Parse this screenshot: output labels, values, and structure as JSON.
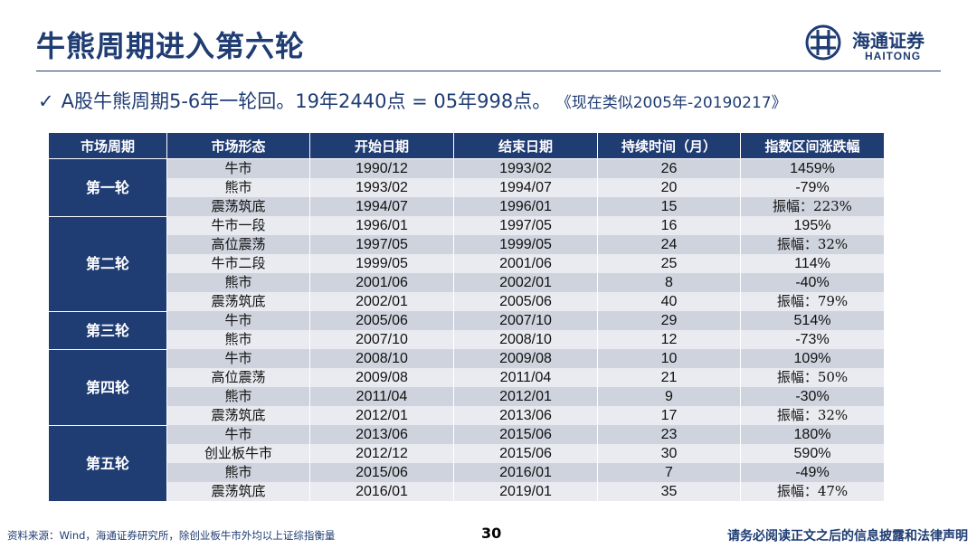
{
  "slide": {
    "title": "牛熊周期进入第六轮",
    "logo_cn": "海通证券",
    "logo_en": "HAITONG",
    "headline_check": "✓",
    "headline": "A股牛熊周期5-6年一轮回。19年2440点 = 05年998点。",
    "headline_note": "《现在类似2005年-20190217》"
  },
  "table": {
    "headers": [
      "市场周期",
      "市场形态",
      "开始日期",
      "结束日期",
      "持续时间（月）",
      "指数区间涨跌幅"
    ],
    "groups": [
      {
        "round": "第一轮",
        "rows": [
          [
            "牛市",
            "1990/12",
            "1993/02",
            "26",
            "1459%"
          ],
          [
            "熊市",
            "1993/02",
            "1994/07",
            "20",
            "-79%"
          ],
          [
            "震荡筑底",
            "1994/07",
            "1996/01",
            "15",
            "振幅：223%"
          ]
        ]
      },
      {
        "round": "第二轮",
        "rows": [
          [
            "牛市一段",
            "1996/01",
            "1997/05",
            "16",
            "195%"
          ],
          [
            "高位震荡",
            "1997/05",
            "1999/05",
            "24",
            "振幅：32%"
          ],
          [
            "牛市二段",
            "1999/05",
            "2001/06",
            "25",
            "114%"
          ],
          [
            "熊市",
            "2001/06",
            "2002/01",
            "8",
            "-40%"
          ],
          [
            "震荡筑底",
            "2002/01",
            "2005/06",
            "40",
            "振幅：79%"
          ]
        ]
      },
      {
        "round": "第三轮",
        "rows": [
          [
            "牛市",
            "2005/06",
            "2007/10",
            "29",
            "514%"
          ],
          [
            "熊市",
            "2007/10",
            "2008/10",
            "12",
            "-73%"
          ]
        ]
      },
      {
        "round": "第四轮",
        "rows": [
          [
            "牛市",
            "2008/10",
            "2009/08",
            "10",
            "109%"
          ],
          [
            "高位震荡",
            "2009/08",
            "2011/04",
            "21",
            "振幅：50%"
          ],
          [
            "熊市",
            "2011/04",
            "2012/01",
            "9",
            "-30%"
          ],
          [
            "震荡筑底",
            "2012/01",
            "2013/06",
            "17",
            "振幅：32%"
          ]
        ]
      },
      {
        "round": "第五轮",
        "rows": [
          [
            "牛市",
            "2013/06",
            "2015/06",
            "23",
            "180%"
          ],
          [
            "创业板牛市",
            "2012/12",
            "2015/06",
            "30",
            "590%"
          ],
          [
            "熊市",
            "2015/06",
            "2016/01",
            "7",
            "-49%"
          ],
          [
            "震荡筑底",
            "2016/01",
            "2019/01",
            "35",
            "振幅：47%"
          ]
        ]
      }
    ]
  },
  "footer": {
    "source": "资料来源：Wind，海通证券研究所，除创业板牛市外均以上证综指衡量",
    "page": "30",
    "disclaimer": "请务必阅读正文之后的信息披露和法律声明"
  },
  "colors": {
    "accent": "#1f3c73",
    "row_dark": "#cfd3de",
    "row_light": "#e9ebf0"
  }
}
